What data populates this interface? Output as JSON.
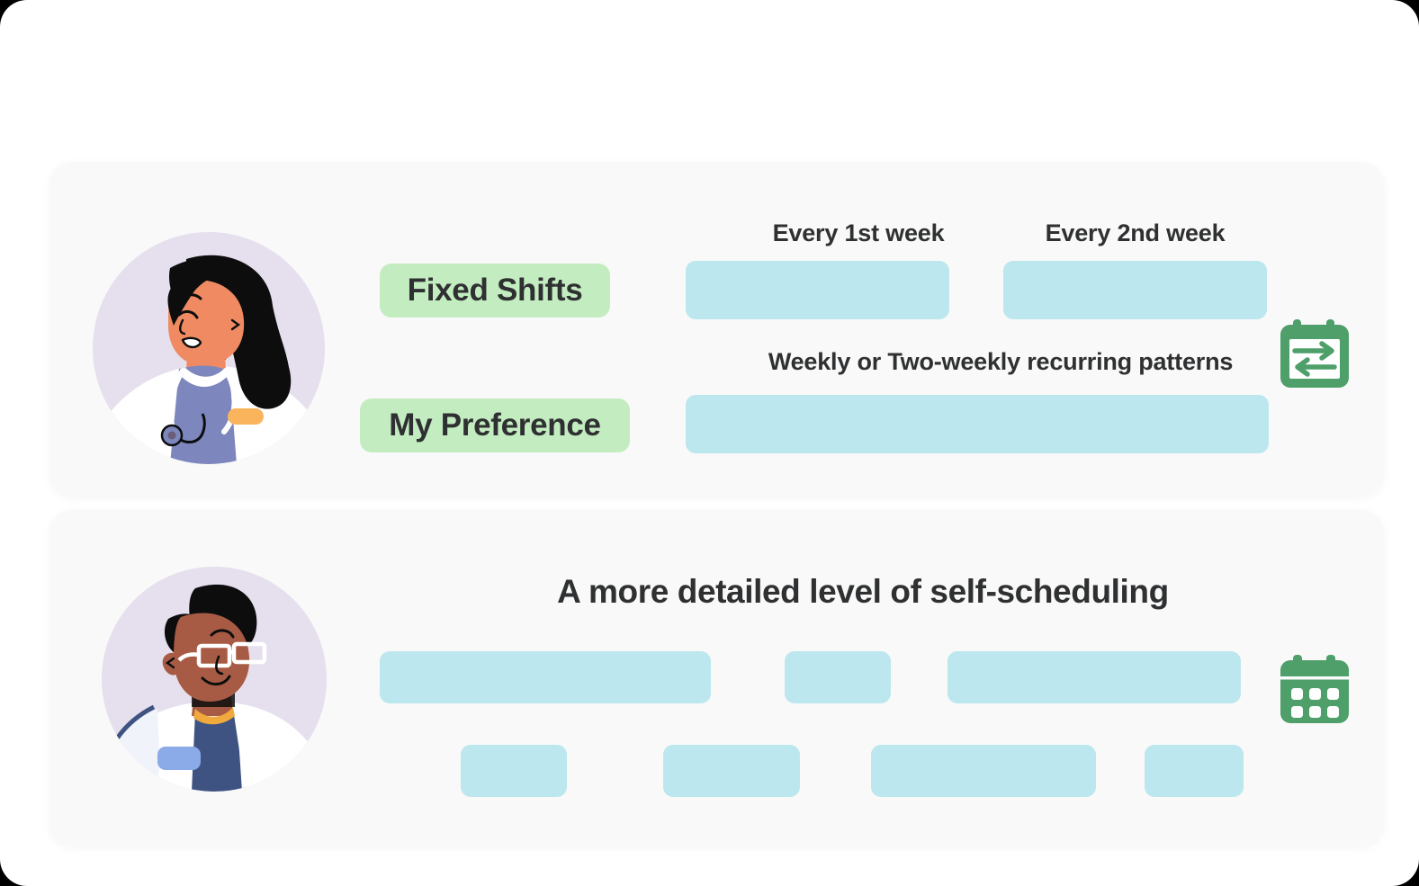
{
  "colors": {
    "page_background": "#ffffff",
    "card_background": "#f9f9f9",
    "badge_green": "#c3edc0",
    "skeleton_blue": "#bde7ee",
    "text_dark": "#2f3031",
    "icon_green": "#4e9f69",
    "avatar_circle": "#e6e0ee"
  },
  "cards": [
    {
      "id": "fixed-shifts",
      "avatar": {
        "name": "nurse-illustration",
        "description": "Nurse with long black ponytail, blue scrubs and stethoscope"
      },
      "badges": [
        {
          "label": "Fixed Shifts"
        },
        {
          "label": "My Preference"
        }
      ],
      "labels": [
        {
          "text": "Every 1st week"
        },
        {
          "text": "Every 2nd week"
        },
        {
          "text": "Weekly or Two-weekly recurring patterns"
        }
      ],
      "placeholders": [
        {
          "name": "week-1-placeholder"
        },
        {
          "name": "week-2-placeholder"
        },
        {
          "name": "recurring-pattern-placeholder"
        }
      ],
      "icon": {
        "name": "shift-swap-calendar-icon",
        "description": "Green calendar with two opposing exchange arrows"
      }
    },
    {
      "id": "self-scheduling",
      "avatar": {
        "name": "doctor-illustration",
        "description": "Doctor with afro hair, white glasses and white lab coat"
      },
      "heading": "A more detailed level of self-scheduling",
      "placeholders_row_1": [
        {
          "name": "detail-placeholder-1"
        },
        {
          "name": "detail-placeholder-2"
        },
        {
          "name": "detail-placeholder-3"
        }
      ],
      "placeholders_row_2": [
        {
          "name": "detail-placeholder-4"
        },
        {
          "name": "detail-placeholder-5"
        },
        {
          "name": "detail-placeholder-6"
        },
        {
          "name": "detail-placeholder-7"
        }
      ],
      "icon": {
        "name": "calendar-grid-icon",
        "description": "Solid green calendar with a 3 by 2 grid of day cells"
      }
    }
  ]
}
